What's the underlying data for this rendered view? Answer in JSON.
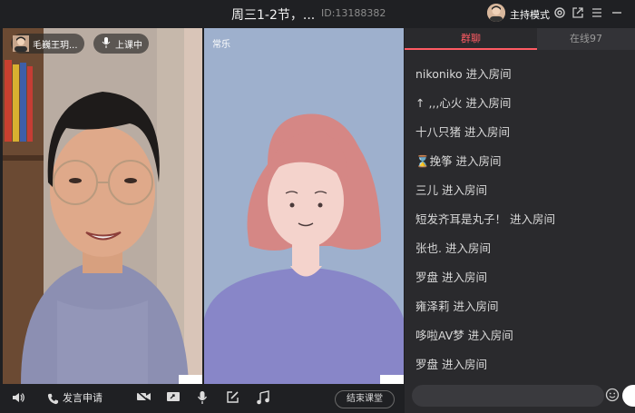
{
  "titlebar": {
    "title": "周三1-2节，...",
    "room_id": "ID:13188382",
    "host_mode": "主持模式",
    "icons": [
      "settings-icon",
      "external-link-icon",
      "menu-icon",
      "minimize-icon"
    ]
  },
  "video_left": {
    "teacher_name": "毛巍王玥...",
    "status": "上课中"
  },
  "video_right": {
    "student_name": "常乐"
  },
  "toolbar": {
    "speak_request": "发言申请",
    "end_class": "结束课堂",
    "icons": [
      "speaker-icon",
      "phone-icon",
      "camera-icon",
      "screen-share-icon",
      "microphone-icon",
      "edit-icon",
      "music-icon"
    ]
  },
  "panel": {
    "tabs": [
      "群聊",
      "在线97"
    ],
    "active_tab": "群聊",
    "messages": [
      {
        "sym": "",
        "text": "nikoniko 进入房间"
      },
      {
        "sym": "",
        "text": "↑ ,,,心火 进入房间"
      },
      {
        "sym": "",
        "text": "十八只猪 进入房间"
      },
      {
        "sym": "⌛",
        "text": "挽筝 进入房间"
      },
      {
        "sym": "",
        "text": "三儿 进入房间"
      },
      {
        "sym": "",
        "text": "短发齐耳是丸子！ 进入房间"
      },
      {
        "sym": "",
        "text": "张也. 进入房间"
      },
      {
        "sym": "",
        "text": "罗盘 进入房间"
      },
      {
        "sym": "",
        "text": "雍泽莉 进入房间"
      },
      {
        "sym": "",
        "text": "哆啦AV梦 进入房间"
      },
      {
        "sym": "",
        "text": "罗盘 进入房间"
      }
    ],
    "accent_color": "#ff5b63"
  }
}
